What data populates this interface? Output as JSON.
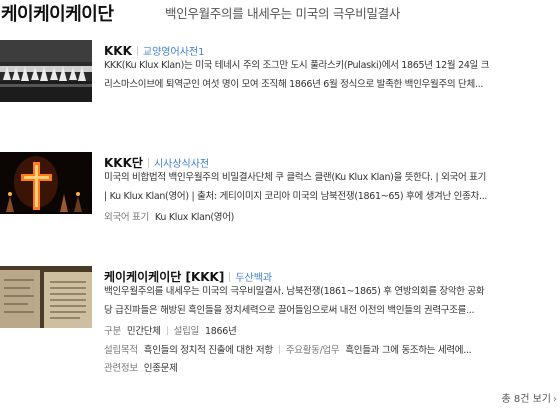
{
  "header": {
    "title": "케이케이케이단",
    "subtitle": "백인우월주의를 내세우는 미국의 극우비밀결사"
  },
  "results": [
    {
      "title": "KKK",
      "source": "교양영어사전1",
      "desc": [
        "KKK(Ku Klux Klan)는 미국 테네시 주의 조그만 도시 풀라스키(Pulaski)에서 1865년 12월 24일 크",
        "리스마스이브에 퇴역군인 여섯 명이 모여 조직해 1866년 6월 정식으로 발족한 백인우월주의 단체..."
      ],
      "image": "kkk-rally-photo"
    },
    {
      "title": "KKK단",
      "source": "시사상식사전",
      "desc": [
        "미국의 비합법적 백인우월주의 비밀결사단체 쿠 클럭스 클랜(Ku Klux Klan)을 뜻한다. | 외국어 표기",
        "| Ku Klux Klan(영어) | 출처: 게티이미지 코리아 미국의 남북전쟁(1861~65) 후에 생겨난 인종차..."
      ],
      "meta": [
        {
          "key": "외국어 표기",
          "value": "Ku Klux Klan(영어)"
        }
      ],
      "image": "burning-cross-photo"
    },
    {
      "title": "케이케이케이단 [KKK]",
      "source": "두산백과",
      "desc": [
        "백인우월주의를 내세우는 미국의 극우비밀결사. 남북전쟁(1861~1865) 후 연방의회를 장악한 공화",
        "당 급진파들은 해방된 흑인들을 정치세력으로 끌어들임으로써 내전 이전의 백인들의 권력구조를..."
      ],
      "meta": [
        {
          "key": "구분",
          "value": "민간단체"
        },
        {
          "key": "설립일",
          "value": "1866년"
        }
      ],
      "meta2": [
        {
          "key": "설립목적",
          "value": "흑인들의 정치적 진출에 대한 저항"
        },
        {
          "key": "주요활동/업무",
          "value": "흑인들과 그에 동조하는 세력에..."
        }
      ],
      "meta3": [
        {
          "key": "관련정보",
          "value": "인종문제"
        }
      ],
      "image": "document-photo"
    }
  ],
  "footer": {
    "more_label": "총 8건 보기"
  }
}
